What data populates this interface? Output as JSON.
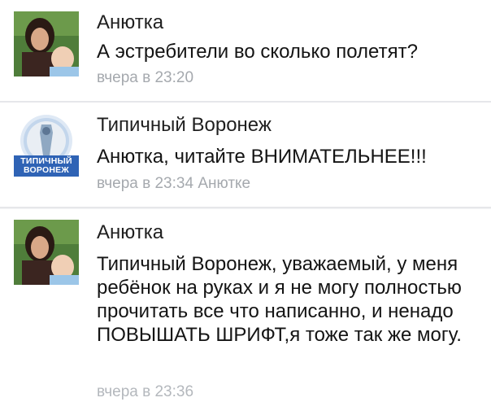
{
  "comments": [
    {
      "author": "Анютка",
      "text": "А эстребители во сколько полетят?",
      "time": "вчера в 23:20",
      "reply_to": ""
    },
    {
      "author": "Типичный Воронеж",
      "text": "Анютка, читайте ВНИМАТЕЛЬНЕЕ!!!",
      "time": "вчера в 23:34",
      "reply_to": "Анютке",
      "avatar_caption": "ТИПИЧНЫЙ ВОРОНЕЖ"
    },
    {
      "author": "Анютка",
      "text": "Типичный Воронеж, уважаемый, у меня ребёнок на руках и я не могу полностью прочитать все что написанно, и ненадо ПОВЫШАТЬ ШРИФТ,я тоже так же могу.",
      "time": "вчера в 23:36"
    }
  ],
  "colors": {
    "meta_text": "#a5a9ae",
    "divider": "#e6e7ea",
    "brand_badge": "#2f63b5"
  }
}
